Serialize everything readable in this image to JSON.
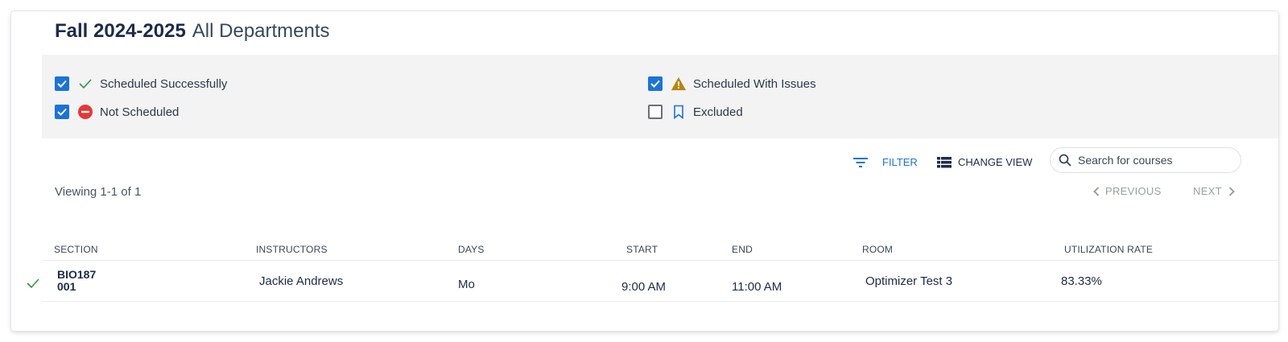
{
  "header": {
    "term": "Fall 2024-2025",
    "department": "All Departments"
  },
  "legend": {
    "items": [
      {
        "label": "Scheduled Successfully",
        "checked": true,
        "icon": "check-icon",
        "color": "#2e9b3e"
      },
      {
        "label": "Not Scheduled",
        "checked": true,
        "icon": "no-entry-icon",
        "color": "#e53935"
      },
      {
        "label": "Scheduled With Issues",
        "checked": true,
        "icon": "warning-icon",
        "color": "#b8860b"
      },
      {
        "label": "Excluded",
        "checked": false,
        "icon": "bookmark-icon",
        "color": "#1a73d9"
      }
    ]
  },
  "toolbar": {
    "filter_label": "FILTER",
    "change_view_label": "CHANGE VIEW",
    "search_placeholder": "Search for courses"
  },
  "pagination": {
    "viewing_text": "Viewing 1-1 of 1",
    "previous_label": "PREVIOUS",
    "next_label": "NEXT"
  },
  "table": {
    "columns": [
      "SECTION",
      "INSTRUCTORS",
      "DAYS",
      "START",
      "END",
      "ROOM",
      "UTILIZATION RATE"
    ],
    "rows": [
      {
        "status_icon": "check-icon",
        "course": "BIO187",
        "section": "001",
        "instructors": "Jackie Andrews",
        "days": "Mo",
        "start": "9:00 AM",
        "end": "11:00 AM",
        "room": "Optimizer Test 3",
        "utilization": "83.33%"
      }
    ]
  },
  "colors": {
    "accent": "#1a73d9",
    "title": "#1c2b4a",
    "legend_bg": "#f3f3f4"
  }
}
